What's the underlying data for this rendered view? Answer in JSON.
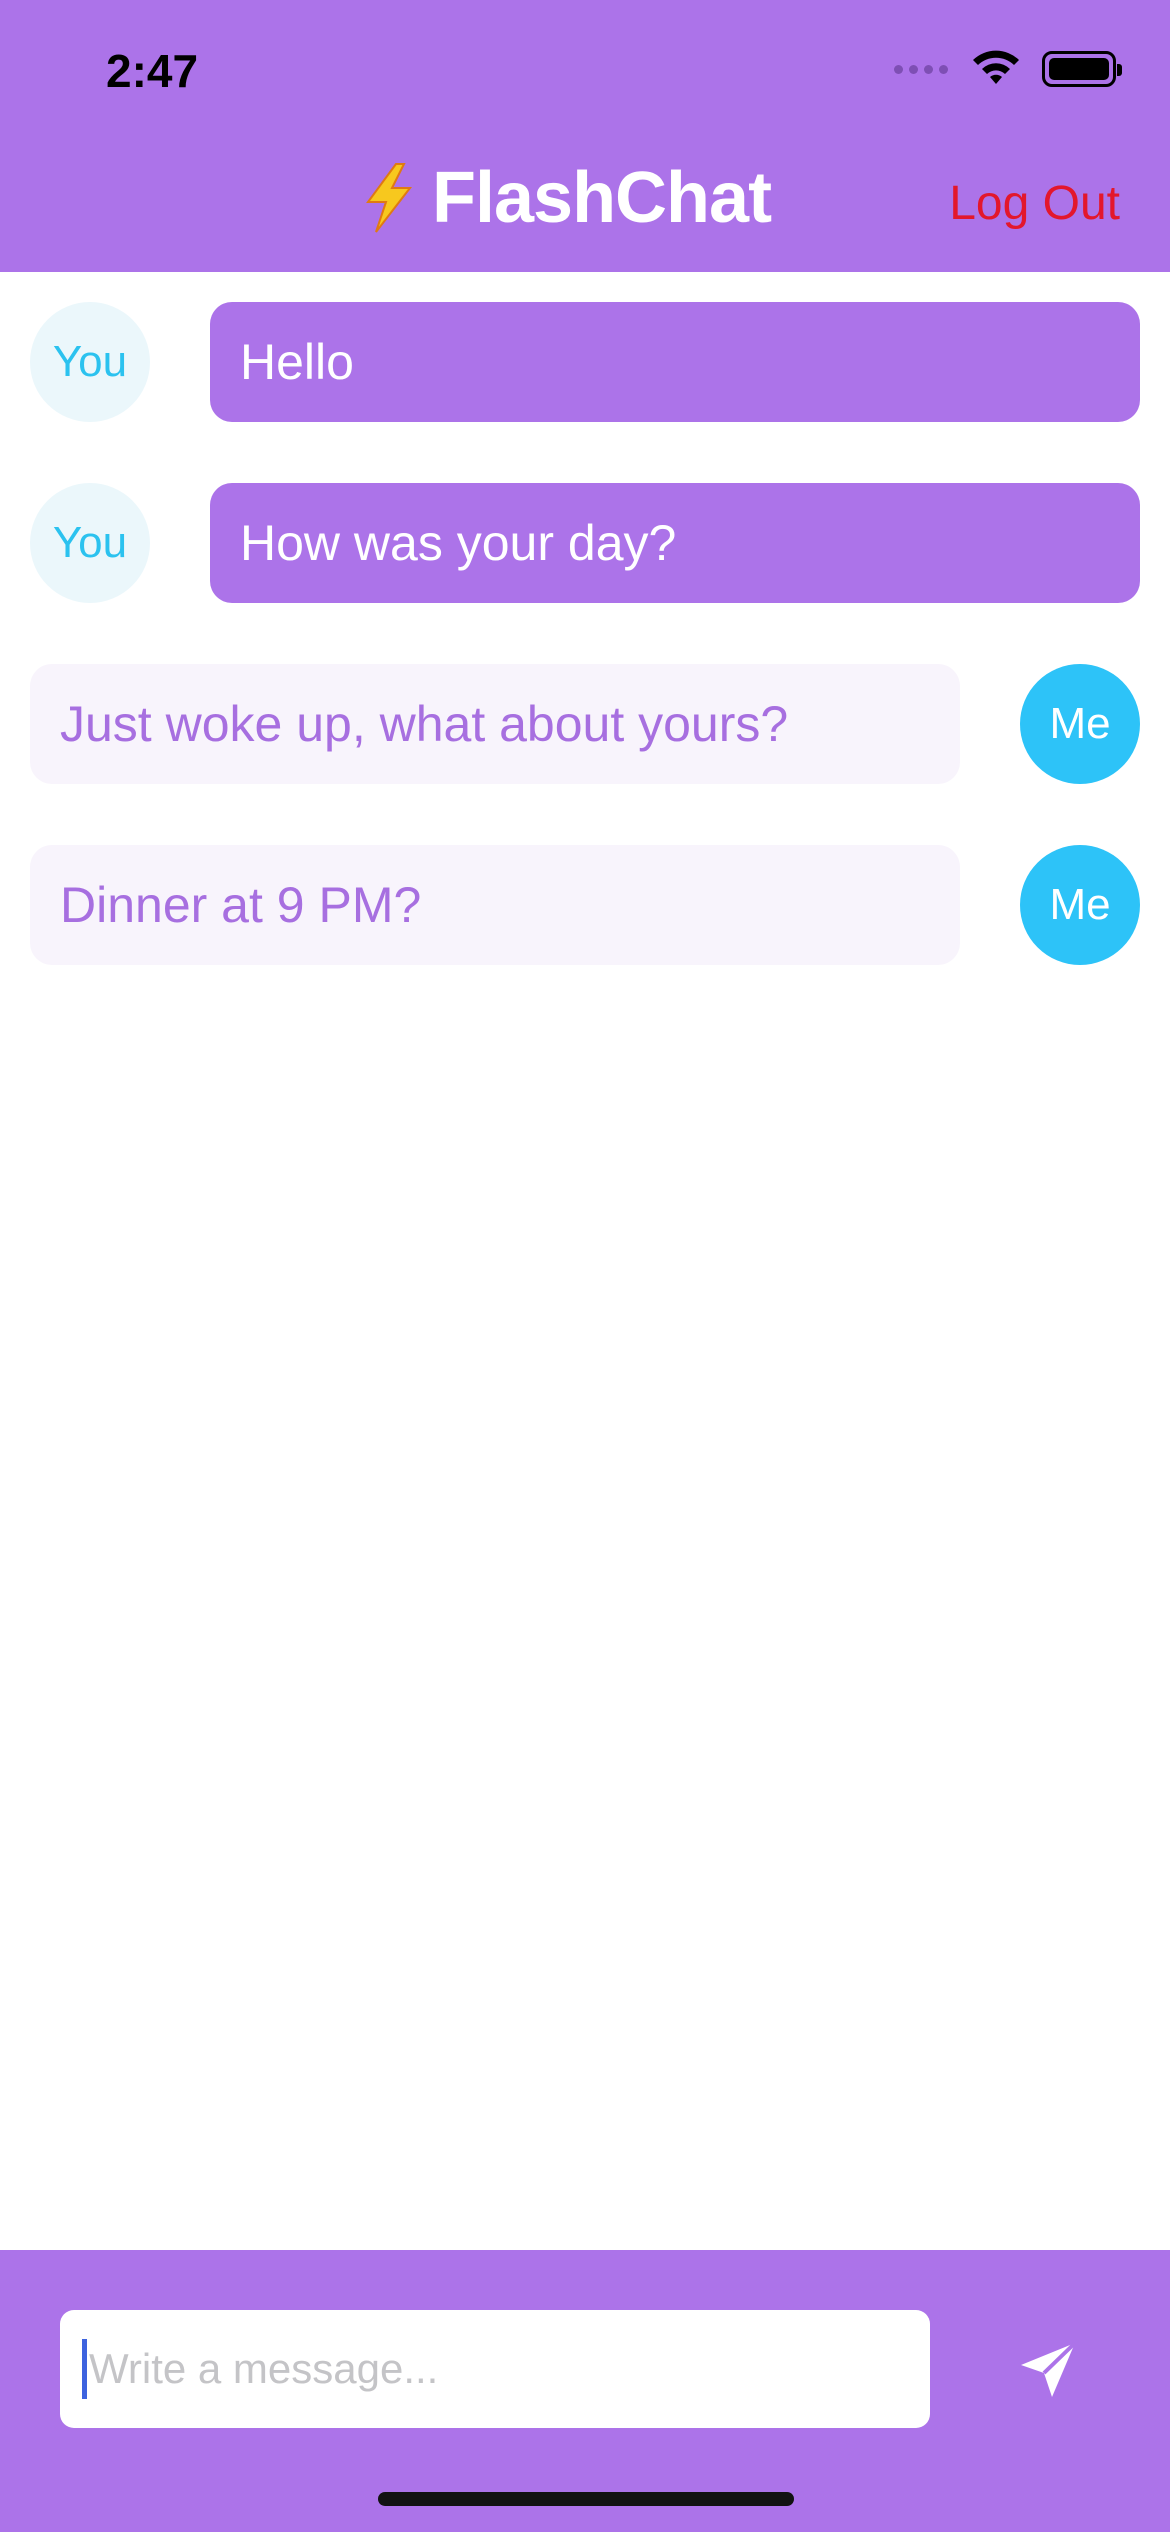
{
  "status_bar": {
    "time": "2:47"
  },
  "header": {
    "title": "FlashChat",
    "logout_label": "Log Out",
    "colors": {
      "background": "#ac73e9",
      "logout": "#e3172c"
    }
  },
  "messages": [
    {
      "sender": "You",
      "text": "Hello"
    },
    {
      "sender": "You",
      "text": "How was your day?"
    },
    {
      "sender": "Me",
      "text": "Just woke up, what about yours?"
    },
    {
      "sender": "Me",
      "text": "Dinner at 9 PM?"
    }
  ],
  "composer": {
    "placeholder": "Write a message...",
    "send_icon": "paper-plane-icon"
  },
  "colors": {
    "accent": "#ac73e9",
    "me_avatar": "#2dc3f8",
    "you_avatar_bg": "#ebf7fb",
    "me_bubble_bg": "#f8f4fc"
  }
}
